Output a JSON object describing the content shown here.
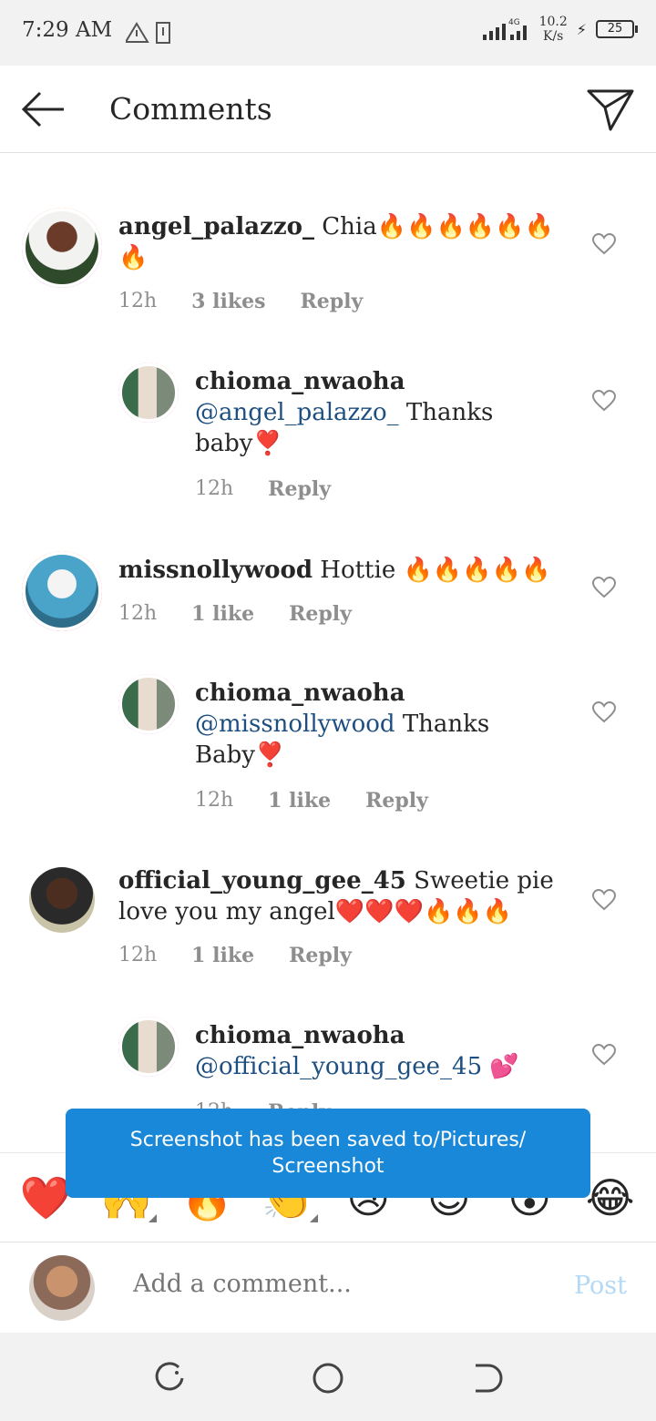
{
  "status": {
    "time": "7:29 AM",
    "net": "4G",
    "speed_value": "10.2",
    "speed_unit": "K/s",
    "battery": "25"
  },
  "header": {
    "title": "Comments"
  },
  "comments": [
    {
      "user": "angel_palazzo_",
      "text": " Chia🔥🔥🔥🔥🔥🔥🔥",
      "time": "12h",
      "likes": "3 likes",
      "reply": "Reply"
    },
    {
      "user": "chioma_nwaoha",
      "mention": "@angel_palazzo_",
      "text": " Thanks baby❣️",
      "time": "12h",
      "reply": "Reply"
    },
    {
      "user": "missnollywood",
      "text": " Hottie 🔥🔥🔥🔥🔥",
      "time": "12h",
      "likes": "1 like",
      "reply": "Reply"
    },
    {
      "user": "chioma_nwaoha",
      "mention": "@missnollywood",
      "text": " Thanks Baby❣️",
      "time": "12h",
      "likes": "1 like",
      "reply": "Reply"
    },
    {
      "user": "official_young_gee_45",
      "text": " Sweetie pie love you my angel❤️❤️❤️🔥🔥🔥",
      "time": "12h",
      "likes": "1 like",
      "reply": "Reply"
    },
    {
      "user": "chioma_nwaoha",
      "mention": "@official_young_gee_45",
      "text": " 💕",
      "time": "12h",
      "reply": "Reply"
    }
  ],
  "toast": {
    "line1": "Screenshot has been saved to/Pictures/",
    "line2": "Screenshot"
  },
  "emoji_bar": [
    "❤️",
    "🙌",
    "🔥",
    "👏",
    "😢",
    "😍",
    "😮",
    "😂"
  ],
  "composer": {
    "placeholder": "Add a comment...",
    "post": "Post"
  },
  "colors": {
    "accent": "#1a88d9",
    "mention": "#1d4f80",
    "meta": "#8e8e8e"
  }
}
